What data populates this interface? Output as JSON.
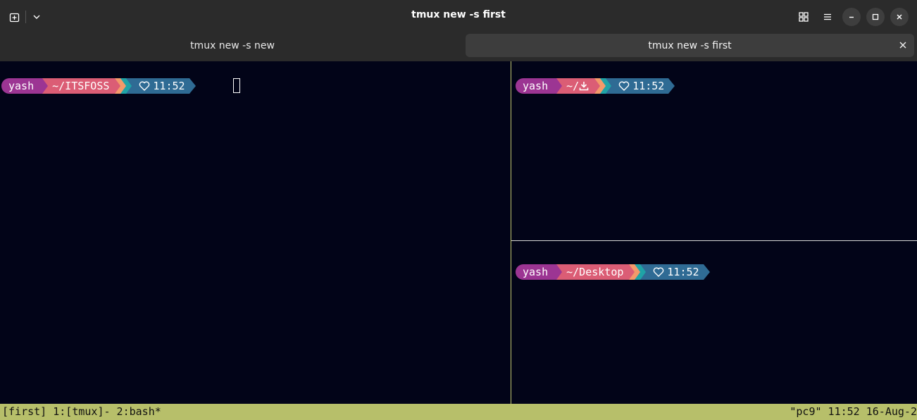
{
  "window": {
    "title": "tmux new -s first"
  },
  "tabs": [
    {
      "label": "tmux new -s new",
      "active": false
    },
    {
      "label": "tmux new -s first",
      "active": true
    }
  ],
  "panes": {
    "left": {
      "user": "yash",
      "dir": "~/ITSFOSS",
      "time": "11:52"
    },
    "top_right": {
      "user": "yash",
      "dir": "~/",
      "dir_icon": "download-icon",
      "time": "11:52"
    },
    "bottom_right": {
      "user": "yash",
      "dir": "~/Desktop",
      "time": "11:52"
    }
  },
  "statusbar": {
    "left": "[first] 1:[tmux]- 2:bash*",
    "right": "\"pc9\" 11:52 16-Aug-2"
  },
  "colors": {
    "terminal_bg": "#020418",
    "user_segment": "#9c3593",
    "dir_segment": "#db5d75",
    "stripe_orange": "#f39a6a",
    "stripe_cyan": "#1fa3a6",
    "time_segment": "#2f6b94",
    "status_bar": "#b7bf6a",
    "pane_border_active": "#c4ca72"
  }
}
